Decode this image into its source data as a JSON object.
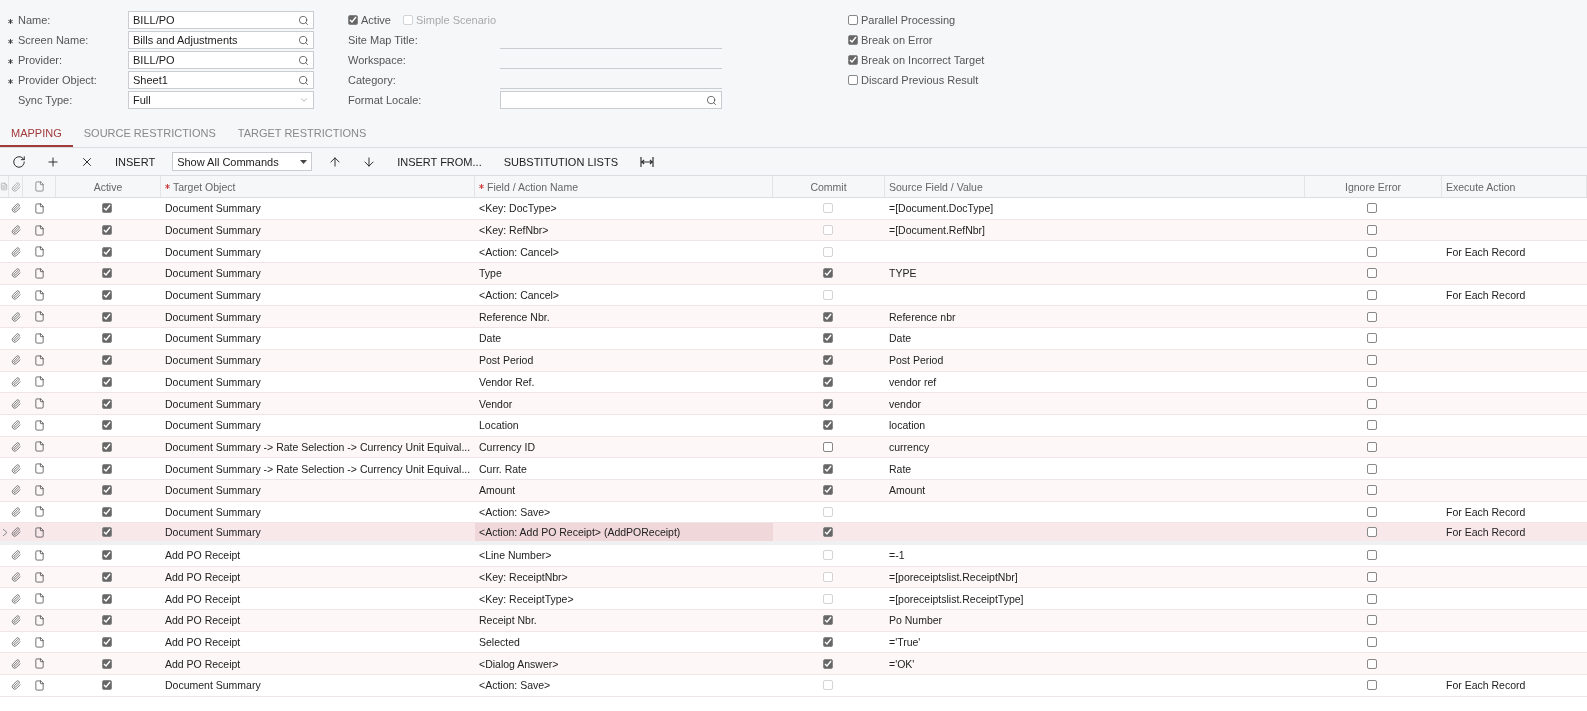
{
  "form": {
    "fields": [
      {
        "label": "Name:",
        "required": true,
        "value": "BILL/PO",
        "kind": "lookup"
      },
      {
        "label": "Screen Name:",
        "required": true,
        "value": "Bills and Adjustments",
        "kind": "lookup"
      },
      {
        "label": "Provider:",
        "required": true,
        "value": "BILL/PO",
        "kind": "lookup"
      },
      {
        "label": "Provider Object:",
        "required": true,
        "value": "Sheet1",
        "kind": "lookup"
      },
      {
        "label": "Sync Type:",
        "required": false,
        "value": "Full",
        "kind": "select"
      }
    ],
    "flags": [
      {
        "label": "Active",
        "checked": true,
        "disabled": false
      },
      {
        "label": "Simple Scenario",
        "checked": false,
        "disabled": true
      }
    ],
    "details": [
      {
        "label": "Site Map Title:",
        "kind": "line"
      },
      {
        "label": "Workspace:",
        "kind": "line"
      },
      {
        "label": "Category:",
        "kind": "line"
      },
      {
        "label": "Format Locale:",
        "kind": "lookup"
      }
    ],
    "options": [
      {
        "label": "Parallel Processing",
        "checked": false
      },
      {
        "label": "Break on Error",
        "checked": true
      },
      {
        "label": "Break on Incorrect Target",
        "checked": true
      },
      {
        "label": "Discard Previous Result",
        "checked": false
      }
    ]
  },
  "tabs": [
    {
      "label": "MAPPING",
      "selected": true
    },
    {
      "label": "SOURCE RESTRICTIONS",
      "selected": false
    },
    {
      "label": "TARGET RESTRICTIONS",
      "selected": false
    }
  ],
  "toolbar": {
    "insert": "INSERT",
    "filter": "Show All Commands",
    "insert_from": "INSERT FROM...",
    "substitution": "SUBSTITUTION LISTS"
  },
  "columns": [
    {
      "label": "Active",
      "required": false
    },
    {
      "label": "Target Object",
      "required": true
    },
    {
      "label": "Field / Action Name",
      "required": true
    },
    {
      "label": "Commit",
      "required": false
    },
    {
      "label": "Source Field / Value",
      "required": false
    },
    {
      "label": "Ignore Error",
      "required": false
    },
    {
      "label": "Execute Action",
      "required": false
    }
  ],
  "rows": [
    {
      "active": true,
      "target": "Document Summary",
      "field": "<Key: DocType>",
      "commit": false,
      "commit_disabled": true,
      "source": "=[Document.DocType]",
      "ignore": false,
      "execute": "",
      "selected": false
    },
    {
      "active": true,
      "target": "Document Summary",
      "field": "<Key: RefNbr>",
      "commit": false,
      "commit_disabled": true,
      "source": "=[Document.RefNbr]",
      "ignore": false,
      "execute": "",
      "selected": false
    },
    {
      "active": true,
      "target": "Document Summary",
      "field": "<Action: Cancel>",
      "commit": false,
      "commit_disabled": true,
      "source": "",
      "ignore": false,
      "execute": "For Each Record",
      "selected": false
    },
    {
      "active": true,
      "target": "Document Summary",
      "field": "Type",
      "commit": true,
      "commit_disabled": false,
      "source": "TYPE",
      "ignore": false,
      "execute": "",
      "selected": false
    },
    {
      "active": true,
      "target": "Document Summary",
      "field": "<Action: Cancel>",
      "commit": false,
      "commit_disabled": true,
      "source": "",
      "ignore": false,
      "execute": "For Each Record",
      "selected": false
    },
    {
      "active": true,
      "target": "Document Summary",
      "field": "Reference Nbr.",
      "commit": true,
      "commit_disabled": false,
      "source": "Reference nbr",
      "ignore": false,
      "execute": "",
      "selected": false
    },
    {
      "active": true,
      "target": "Document Summary",
      "field": "Date",
      "commit": true,
      "commit_disabled": false,
      "source": "Date",
      "ignore": false,
      "execute": "",
      "selected": false
    },
    {
      "active": true,
      "target": "Document Summary",
      "field": "Post Period",
      "commit": true,
      "commit_disabled": false,
      "source": "Post Period",
      "ignore": false,
      "execute": "",
      "selected": false
    },
    {
      "active": true,
      "target": "Document Summary",
      "field": "Vendor Ref.",
      "commit": true,
      "commit_disabled": false,
      "source": "vendor ref",
      "ignore": false,
      "execute": "",
      "selected": false
    },
    {
      "active": true,
      "target": "Document Summary",
      "field": "Vendor",
      "commit": true,
      "commit_disabled": false,
      "source": "vendor",
      "ignore": false,
      "execute": "",
      "selected": false
    },
    {
      "active": true,
      "target": "Document Summary",
      "field": "Location",
      "commit": true,
      "commit_disabled": false,
      "source": "location",
      "ignore": false,
      "execute": "",
      "selected": false
    },
    {
      "active": true,
      "target": "Document Summary -> Rate Selection -> Currency Unit Equival...",
      "field": "Currency ID",
      "commit": false,
      "commit_disabled": false,
      "source": "currency",
      "ignore": false,
      "execute": "",
      "selected": false
    },
    {
      "active": true,
      "target": "Document Summary -> Rate Selection -> Currency Unit Equival...",
      "field": "Curr. Rate",
      "commit": true,
      "commit_disabled": false,
      "source": "Rate",
      "ignore": false,
      "execute": "",
      "selected": false
    },
    {
      "active": true,
      "target": "Document Summary",
      "field": "Amount",
      "commit": true,
      "commit_disabled": false,
      "source": "Amount",
      "ignore": false,
      "execute": "",
      "selected": false
    },
    {
      "active": true,
      "target": "Document Summary",
      "field": "<Action: Save>",
      "commit": false,
      "commit_disabled": true,
      "source": "",
      "ignore": false,
      "execute": "For Each Record",
      "selected": false
    },
    {
      "active": true,
      "target": "Document Summary",
      "field": "<Action: Add PO Receipt> (AddPOReceipt)",
      "commit": true,
      "commit_disabled": false,
      "source": "",
      "ignore": false,
      "execute": "For Each Record",
      "selected": true
    },
    {
      "active": true,
      "target": "Add PO Receipt",
      "field": "<Line Number>",
      "commit": false,
      "commit_disabled": true,
      "source": "=-1",
      "ignore": false,
      "execute": "",
      "selected": false
    },
    {
      "active": true,
      "target": "Add PO Receipt",
      "field": "<Key: ReceiptNbr>",
      "commit": false,
      "commit_disabled": true,
      "source": "=[poreceiptslist.ReceiptNbr]",
      "ignore": false,
      "execute": "",
      "selected": false
    },
    {
      "active": true,
      "target": "Add PO Receipt",
      "field": "<Key: ReceiptType>",
      "commit": false,
      "commit_disabled": true,
      "source": "=[poreceiptslist.ReceiptType]",
      "ignore": false,
      "execute": "",
      "selected": false
    },
    {
      "active": true,
      "target": "Add PO Receipt",
      "field": "Receipt Nbr.",
      "commit": true,
      "commit_disabled": false,
      "source": "Po Number",
      "ignore": false,
      "execute": "",
      "selected": false
    },
    {
      "active": true,
      "target": "Add PO Receipt",
      "field": "Selected",
      "commit": true,
      "commit_disabled": false,
      "source": "='True'",
      "ignore": false,
      "execute": "",
      "selected": false
    },
    {
      "active": true,
      "target": "Add PO Receipt",
      "field": "<Dialog Answer>",
      "commit": true,
      "commit_disabled": false,
      "source": "='OK'",
      "ignore": false,
      "execute": "",
      "selected": false
    },
    {
      "active": true,
      "target": "Document Summary",
      "field": "<Action: Save>",
      "commit": false,
      "commit_disabled": true,
      "source": "",
      "ignore": false,
      "execute": "For Each Record",
      "selected": false
    }
  ]
}
